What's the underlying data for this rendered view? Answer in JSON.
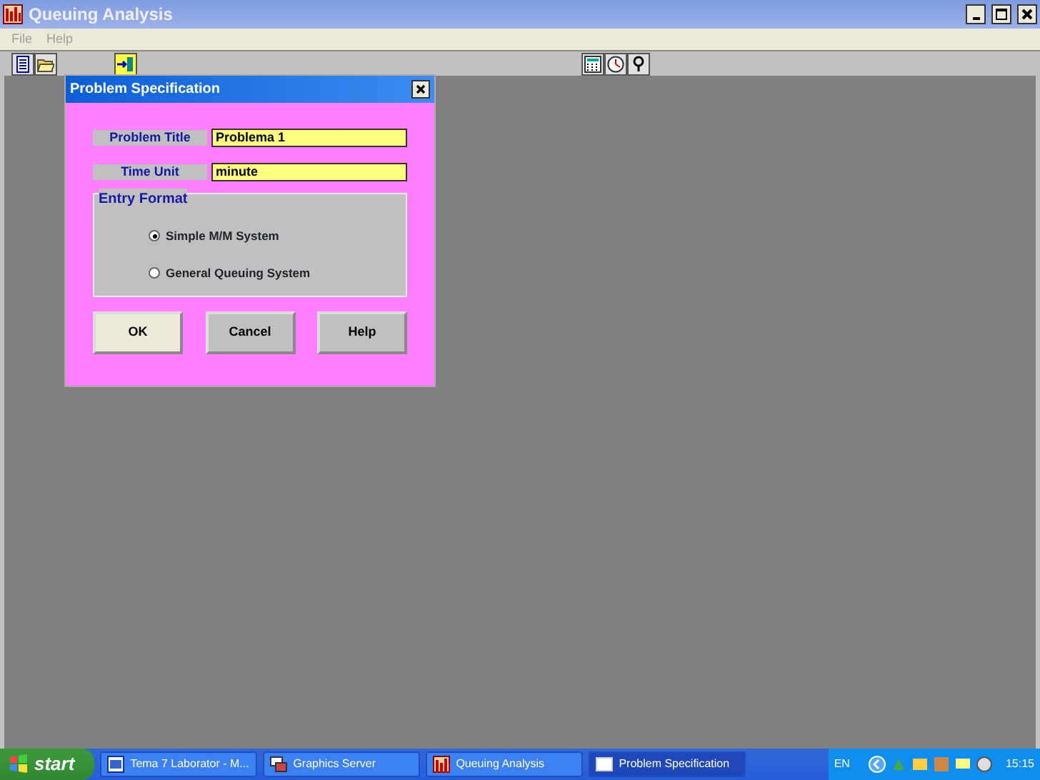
{
  "window": {
    "title": "Queuing Analysis"
  },
  "menu": [
    {
      "label": "File",
      "disabled": true
    },
    {
      "label": "Help",
      "disabled": true
    }
  ],
  "dialog": {
    "title": "Problem Specification",
    "fields": [
      {
        "label": "Problem Title",
        "value": "Problema 1"
      },
      {
        "label": "Time Unit",
        "value": "minute"
      }
    ],
    "entry_format": {
      "title": "Entry Format",
      "options": [
        {
          "label": "Simple M/M System",
          "selected": true
        },
        {
          "label": "General Queuing System",
          "selected": false
        }
      ]
    },
    "buttons": [
      {
        "label": "OK",
        "selected": true
      },
      {
        "label": "Cancel",
        "selected": false
      },
      {
        "label": "Help",
        "selected": false
      }
    ]
  },
  "taskbar": {
    "start": "start",
    "items": [
      {
        "label": "Tema 7 Laborator - M...",
        "selected": false
      },
      {
        "label": "Graphics Server",
        "selected": false
      },
      {
        "label": "Queuing Analysis",
        "selected": false
      },
      {
        "label": "Problem Specification",
        "selected": true
      }
    ],
    "language": "EN",
    "time": "15:15"
  }
}
